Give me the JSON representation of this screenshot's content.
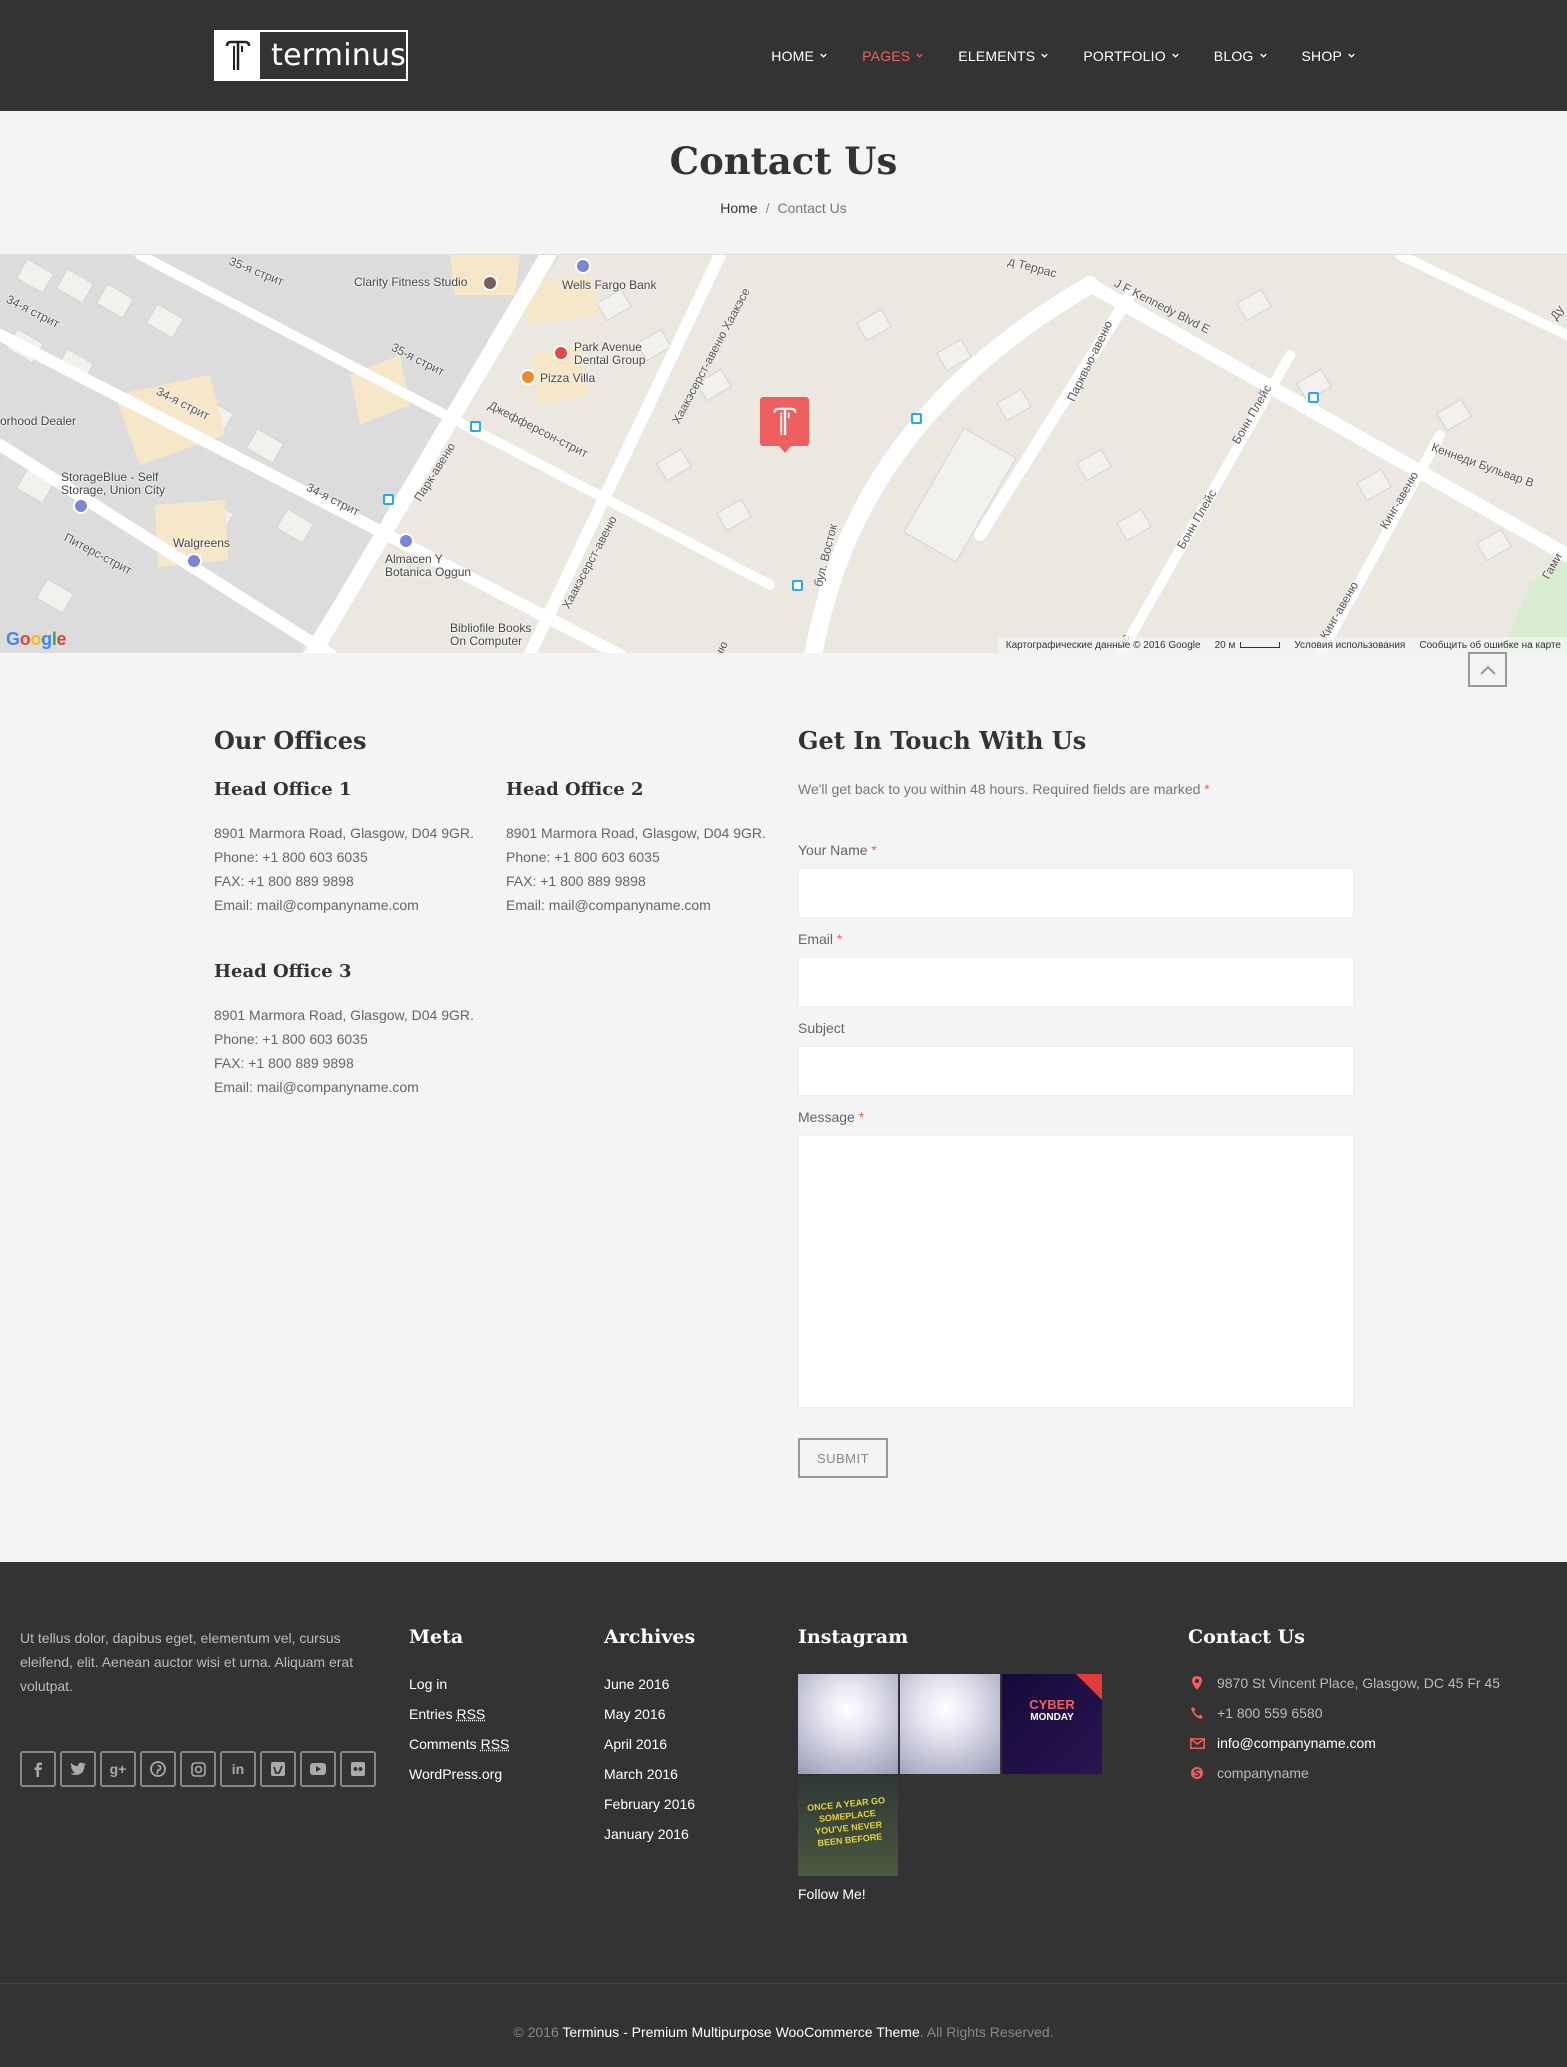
{
  "header": {
    "logo_text": "terminus",
    "nav": [
      {
        "label": "HOME",
        "active": false
      },
      {
        "label": "PAGES",
        "active": true
      },
      {
        "label": "ELEMENTS",
        "active": false
      },
      {
        "label": "PORTFOLIO",
        "active": false
      },
      {
        "label": "BLOG",
        "active": false
      },
      {
        "label": "SHOP",
        "active": false
      }
    ]
  },
  "title_bar": {
    "title": "Contact Us",
    "breadcrumb_home": "Home",
    "breadcrumb_sep": "/",
    "breadcrumb_current": "Contact Us"
  },
  "map": {
    "labels": {
      "clarity": "Clarity Fitness Studio",
      "wells": "Wells Fargo Bank",
      "park_avenue_1": "Park Avenue",
      "park_avenue_2": "Dental Group",
      "pizza": "Pizza Villa",
      "neighborhood": "orhood Dealer",
      "storage_1": "StorageBlue - Self",
      "storage_2": "Storage, Union City",
      "walgreens": "Walgreens",
      "almacen_1": "Almacen Y",
      "almacen_2": "Botanica Oggun",
      "biblio_1": "Bibliofile Books",
      "biblio_2": "On Computer",
      "street_35a": "35-я стрит",
      "street_35b": "35-я стрит",
      "street_34a": "34-я стрит",
      "street_34b": "34-я стрит",
      "street_34c": "34-я стрит",
      "peters": "Питерс-стрит",
      "park_ave": "Парк-авеню",
      "jefferson": "Джефферсон-стрит",
      "hackensack_1": "Хаакэсерст-авеню Хаакэсе",
      "hackensack_2": "Хаакэсерст-авеню",
      "vostok": "бул. Восток",
      "parkview": "Парквью-авеню",
      "jfk": "J F Kennedy Blvd E",
      "terrace": "д Террас",
      "bonn_1": "Бонн Плейс",
      "bonn_2": "Бонн Плейс",
      "king_1": "Кинг-авеню",
      "king_2": "Кинг-авеню",
      "kennedy_blvd": "Кеннеди Бульвар В",
      "gami": "Гами",
      "du": "Ду",
      "no": "ню",
      "ac": "ас"
    },
    "google": "Google",
    "footer": {
      "data": "Картографические данные © 2016 Google",
      "scale": "20 м",
      "terms": "Условия использования",
      "report": "Сообщить об ошибке на карте"
    }
  },
  "offices": {
    "heading": "Our Offices",
    "list": [
      {
        "name": "Head Office 1",
        "address": "8901 Marmora Road, Glasgow, D04 9GR.",
        "phone": "Phone: +1 800 603 6035",
        "fax": "FAX: +1 800 889 9898",
        "email": "Email: mail@companyname.com"
      },
      {
        "name": "Head Office 2",
        "address": "8901 Marmora Road, Glasgow, D04 9GR.",
        "phone": "Phone: +1 800 603 6035",
        "fax": "FAX: +1 800 889 9898",
        "email": "Email: mail@companyname.com"
      },
      {
        "name": "Head Office 3",
        "address": "8901 Marmora Road, Glasgow, D04 9GR.",
        "phone": "Phone: +1 800 603 6035",
        "fax": "FAX: +1 800 889 9898",
        "email": "Email: mail@companyname.com"
      }
    ]
  },
  "form": {
    "heading": "Get In Touch With Us",
    "intro": "We'll get back to you within 48 hours. Required fields are marked",
    "required_mark": "*",
    "name_label": "Your Name",
    "email_label": "Email",
    "subject_label": "Subject",
    "message_label": "Message",
    "submit": "SUBMIT"
  },
  "footer": {
    "about": "Ut tellus dolor, dapibus eget, elementum vel, cursus eleifend, elit. Aenean auctor wisi et urna. Aliquam erat volutpat.",
    "social": [
      "facebook-icon",
      "twitter-icon",
      "google-plus-icon",
      "pinterest-icon",
      "instagram-icon",
      "linkedin-icon",
      "vimeo-icon",
      "youtube-icon",
      "flickr-icon"
    ],
    "meta": {
      "heading": "Meta",
      "log_in": "Log in",
      "entries": "Entries",
      "comments": "Comments",
      "rss": "RSS",
      "wordpress": "WordPress.org"
    },
    "archives": {
      "heading": "Archives",
      "items": [
        "June 2016",
        "May 2016",
        "April 2016",
        "March 2016",
        "February 2016",
        "January 2016"
      ]
    },
    "instagram": {
      "heading": "Instagram",
      "cyber_1": "CYBER",
      "cyber_2": "MONDAY",
      "quote": "ONCE A YEAR GO SOMEPLACE YOU'VE NEVER BEEN BEFORE",
      "follow": "Follow Me!"
    },
    "contact": {
      "heading": "Contact Us",
      "address": "9870 St Vincent Place, Glasgow, DC 45 Fr 45",
      "phone": "+1 800 559 6580",
      "email": "info@companyname.com",
      "skype": "companyname"
    },
    "copyright_prefix": "© 2016",
    "copyright_link": "Terminus - Premium Multipurpose WooCommerce Theme",
    "copyright_suffix": ". All Rights Reserved."
  },
  "colors": {
    "accent": "#f05f5f",
    "header_bg": "#333333",
    "page_bg": "#f4f4f4"
  }
}
